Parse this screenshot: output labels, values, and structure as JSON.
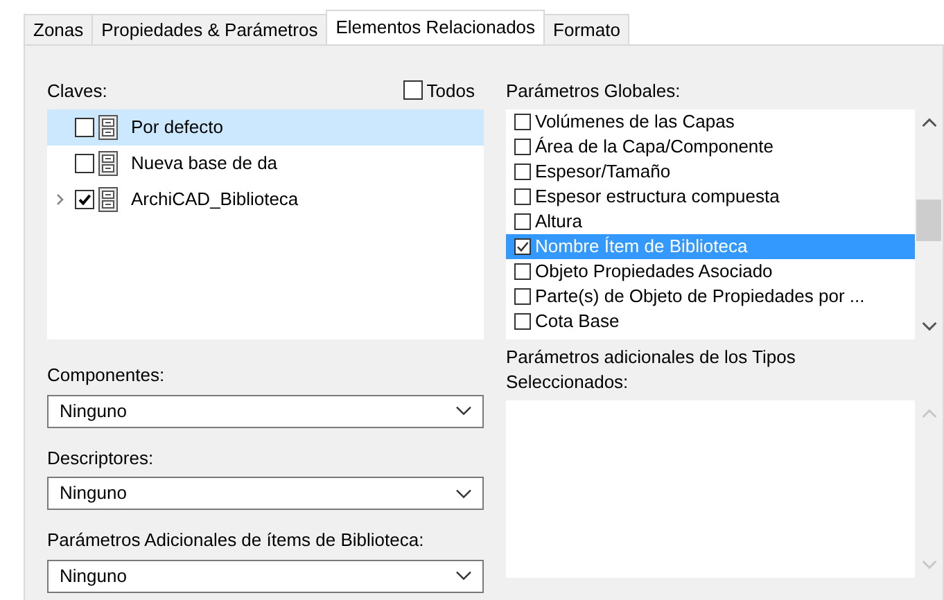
{
  "tabs": [
    {
      "label": "Zonas",
      "selected": false
    },
    {
      "label": "Propiedades & Parámetros",
      "selected": false
    },
    {
      "label": "Elementos Relacionados",
      "selected": true
    },
    {
      "label": "Formato",
      "selected": false
    }
  ],
  "keys": {
    "label": "Claves:",
    "all_checkbox": {
      "label": "Todos",
      "checked": false
    },
    "items": [
      {
        "label": "Por defecto",
        "checked": false,
        "selected": true,
        "expandable": false
      },
      {
        "label": "Nueva base de da",
        "checked": false,
        "selected": false,
        "expandable": false
      },
      {
        "label": "ArchiCAD_Biblioteca",
        "checked": true,
        "selected": false,
        "expandable": true
      }
    ]
  },
  "global_params": {
    "label": "Parámetros Globales:",
    "items": [
      {
        "label": "Volúmenes de las Capas",
        "checked": false,
        "selected": false
      },
      {
        "label": "Área de la Capa/Componente",
        "checked": false,
        "selected": false
      },
      {
        "label": "Espesor/Tamaño",
        "checked": false,
        "selected": false
      },
      {
        "label": "Espesor estructura compuesta",
        "checked": false,
        "selected": false
      },
      {
        "label": "Altura",
        "checked": false,
        "selected": false
      },
      {
        "label": "Nombre Ítem de Biblioteca",
        "checked": true,
        "selected": true
      },
      {
        "label": "Objeto Propiedades Asociado",
        "checked": false,
        "selected": false
      },
      {
        "label": "Parte(s) de Objeto de Propiedades por ...",
        "checked": false,
        "selected": false
      },
      {
        "label": "Cota Base",
        "checked": false,
        "selected": false
      }
    ]
  },
  "dropdowns": [
    {
      "label": "Componentes:",
      "value": "Ninguno"
    },
    {
      "label": "Descriptores:",
      "value": "Ninguno"
    },
    {
      "label": "Parámetros Adicionales de ítems de Biblioteca:",
      "value": "Ninguno"
    }
  ],
  "extra_params": {
    "label": "Parámetros adicionales de los Tipos Seleccionados:"
  }
}
